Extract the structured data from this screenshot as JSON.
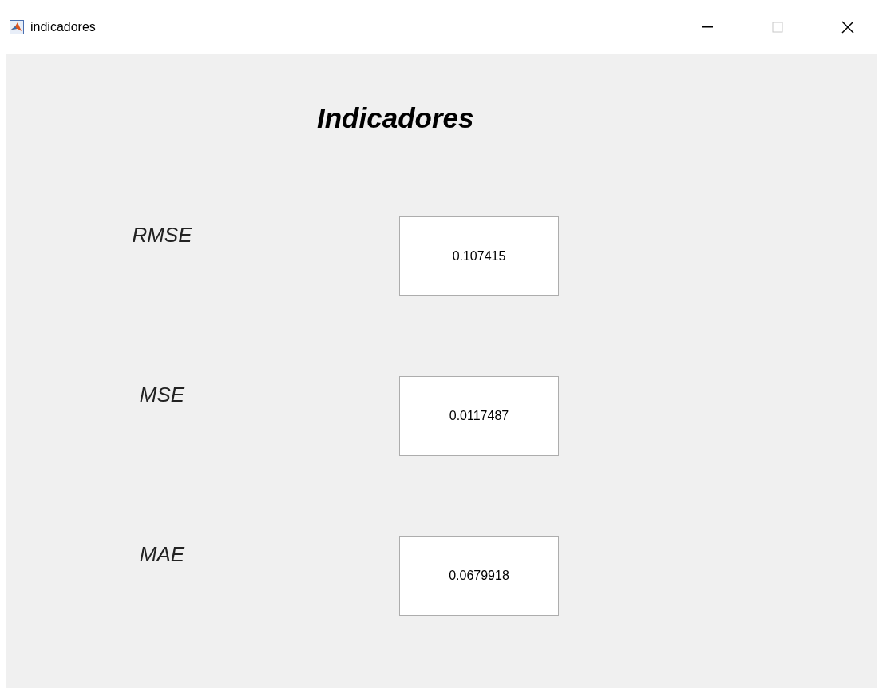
{
  "window": {
    "title": "indicadores",
    "maximize_disabled": true
  },
  "heading": "Indicadores",
  "metrics": [
    {
      "label": "RMSE",
      "value": "0.107415"
    },
    {
      "label": "MSE",
      "value": "0.0117487"
    },
    {
      "label": "MAE",
      "value": "0.0679918"
    }
  ]
}
